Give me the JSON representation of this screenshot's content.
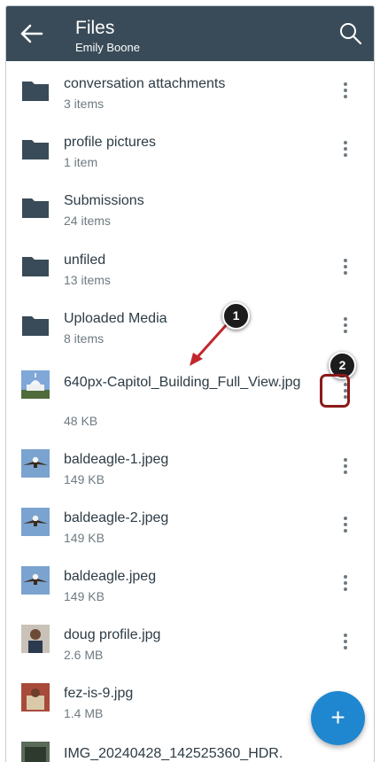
{
  "header": {
    "title": "Files",
    "subtitle": "Emily Boone"
  },
  "icons": {
    "back": "arrow-left-icon",
    "search": "search-icon",
    "menu": "kebab-menu-icon",
    "folder": "folder-icon",
    "image": "image-thumbnail-icon",
    "add": "plus-icon"
  },
  "items": [
    {
      "name": "conversation attachments",
      "meta": "3 items",
      "kind": "folder"
    },
    {
      "name": "profile pictures",
      "meta": "1 item",
      "kind": "folder"
    },
    {
      "name": "Submissions",
      "meta": "24 items",
      "kind": "folder"
    },
    {
      "name": "unfiled",
      "meta": "13 items",
      "kind": "folder"
    },
    {
      "name": "Uploaded Media",
      "meta": "8 items",
      "kind": "folder"
    },
    {
      "name": "640px-Capitol_Building_Full_View.jpg",
      "meta": "48 KB",
      "kind": "image"
    },
    {
      "name": "baldeagle-1.jpeg",
      "meta": "149 KB",
      "kind": "image"
    },
    {
      "name": "baldeagle-2.jpeg",
      "meta": "149 KB",
      "kind": "image"
    },
    {
      "name": "baldeagle.jpeg",
      "meta": "149 KB",
      "kind": "image"
    },
    {
      "name": "doug profile.jpg",
      "meta": "2.6 MB",
      "kind": "image"
    },
    {
      "name": "fez-is-9.jpg",
      "meta": "1.4 MB",
      "kind": "image"
    },
    {
      "name": "IMG_20240428_142525360_HDR.",
      "meta": "",
      "kind": "image"
    }
  ],
  "callouts": {
    "first": "1",
    "second": "2"
  },
  "fab": {
    "label": "+"
  },
  "colors": {
    "appbar": "#394b58",
    "fab": "#1f86d0",
    "highlight": "#8b1a1a"
  }
}
